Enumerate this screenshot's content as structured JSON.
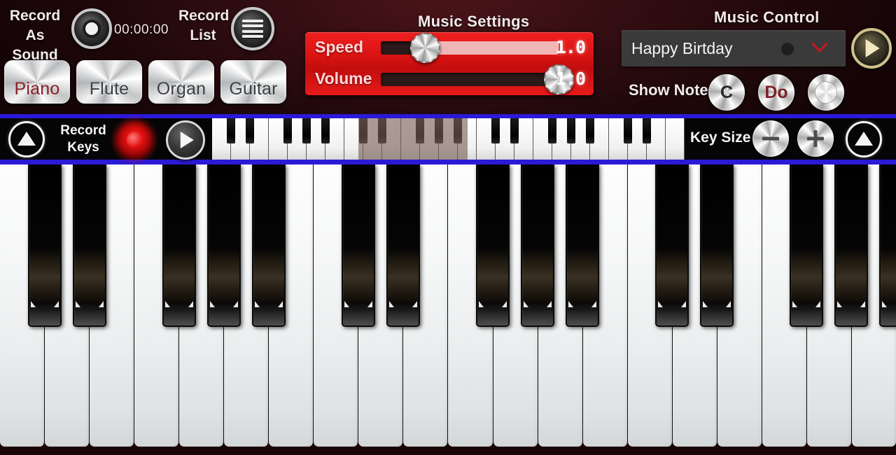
{
  "app": {
    "accent_red": "#d81212",
    "accent_blue": "#2a1ad8",
    "background": "#2e0c10",
    "active_instrument_color": "#8a1f25"
  },
  "record_as_sound": {
    "label_line1": "Record",
    "label_line2": "As Sound",
    "button_icon": "record-dot-icon",
    "timer": "00:00:00"
  },
  "record_list": {
    "label_line1": "Record",
    "label_line2": "List",
    "button_icon": "list-icon"
  },
  "instruments": {
    "items": [
      {
        "label": "Piano",
        "active": true
      },
      {
        "label": "Flute",
        "active": false
      },
      {
        "label": "Organ",
        "active": false
      },
      {
        "label": "Guitar",
        "active": false
      }
    ]
  },
  "music_settings": {
    "title": "Music Settings",
    "sliders": [
      {
        "label": "Speed",
        "value": "1.0",
        "knob_percent": 25
      },
      {
        "label": "Volume",
        "value": "1.0",
        "knob_percent": 100
      }
    ]
  },
  "music_control": {
    "title": "Music Control",
    "selected_song": "Happy Birtday",
    "dropdown_icon": "chevron-down-icon",
    "play_icon": "play-icon",
    "show_notes_label": "Show Notes",
    "note_buttons": [
      {
        "label": "C",
        "state": "inactive"
      },
      {
        "label": "Do",
        "state": "active"
      },
      {
        "label": "",
        "state": "off"
      }
    ]
  },
  "control_bar": {
    "scroll_up_left_icon": "triangle-up-icon",
    "scroll_up_right_icon": "triangle-up-icon",
    "record_keys_line1": "Record",
    "record_keys_line2": "Keys",
    "record_icon": "record-circle-icon",
    "play_icon": "play-icon",
    "key_size_label": "Key Size",
    "key_size_minus_icon": "minus-icon",
    "key_size_plus_icon": "plus-icon",
    "mini_keyboard": {
      "white_key_count": 25,
      "viewport_start_percent": 31,
      "viewport_width_percent": 23
    }
  },
  "keyboard": {
    "white_key_count": 20,
    "black_key_positions": [
      1,
      2,
      4,
      5,
      6,
      8,
      9,
      11,
      12,
      13,
      15,
      16,
      18,
      19,
      20
    ]
  }
}
